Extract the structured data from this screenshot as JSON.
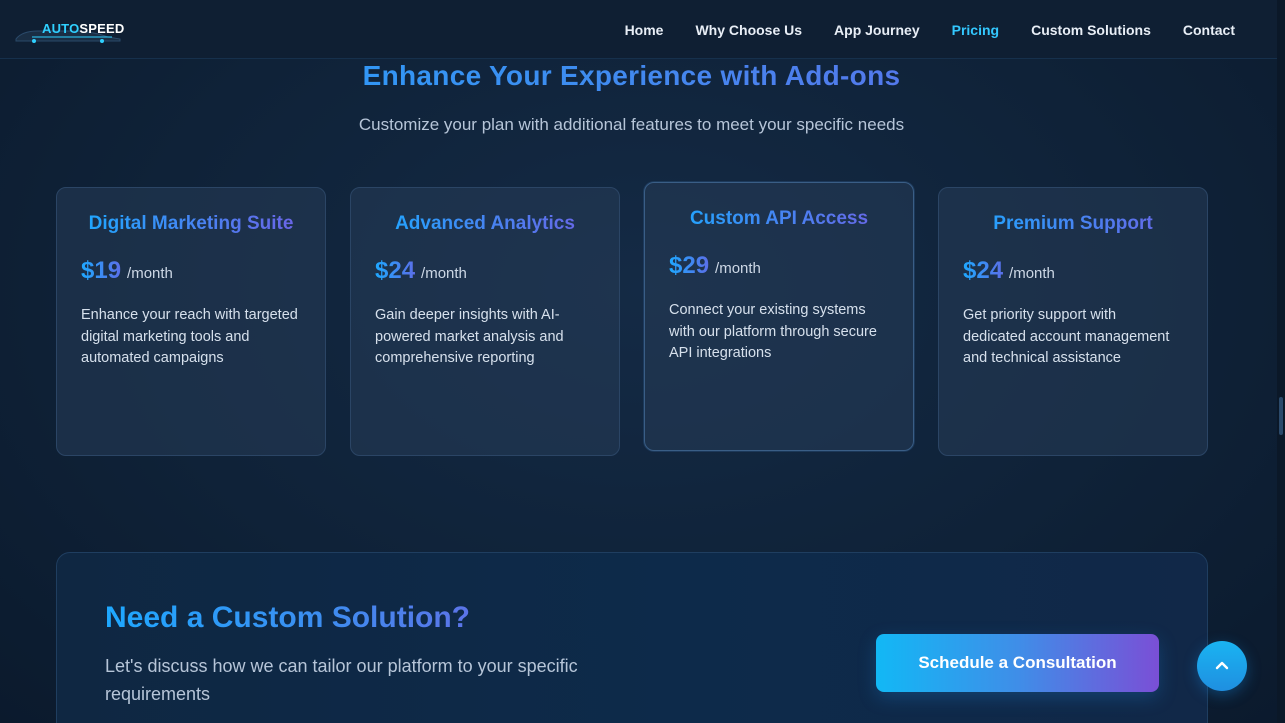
{
  "nav": {
    "logo": {
      "part1": "AUTO",
      "part2": "SPEED"
    },
    "links": [
      {
        "label": "Home"
      },
      {
        "label": "Why Choose Us"
      },
      {
        "label": "App Journey"
      },
      {
        "label": "Pricing",
        "active": true
      },
      {
        "label": "Custom Solutions"
      },
      {
        "label": "Contact"
      }
    ]
  },
  "addons": {
    "title": "Enhance Your Experience with Add-ons",
    "subtitle": "Customize your plan with additional features to meet your specific needs",
    "cards": [
      {
        "title": "Digital Marketing Suite",
        "price": "$19",
        "period": "/month",
        "description": "Enhance your reach with targeted digital marketing tools and automated campaigns"
      },
      {
        "title": "Advanced Analytics",
        "price": "$24",
        "period": "/month",
        "description": "Gain deeper insights with AI-powered market analysis and comprehensive reporting"
      },
      {
        "title": "Custom API Access",
        "price": "$29",
        "period": "/month",
        "description": "Connect your existing systems with our platform through secure API integrations"
      },
      {
        "title": "Premium Support",
        "price": "$24",
        "period": "/month",
        "description": "Get priority support with dedicated account management and technical assistance"
      }
    ]
  },
  "cta": {
    "title": "Need a Custom Solution?",
    "subtitle": "Let's discuss how we can tailor our platform to your specific requirements",
    "button_label": "Schedule a Consultation"
  },
  "icons": {
    "scroll_top": "chevron-up-icon"
  },
  "colors": {
    "accent": "#33c8ff",
    "gradient_start": "#1ea8ff",
    "gradient_end": "#6c63e6"
  }
}
